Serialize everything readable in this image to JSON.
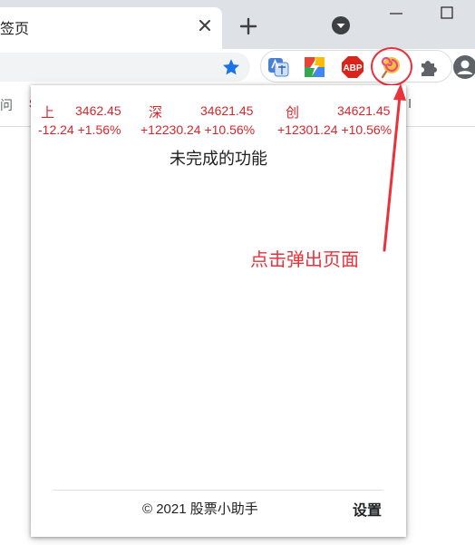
{
  "browser": {
    "tab_title": "签页",
    "bookmarks_left": "问",
    "bookmarks_left_red": "S",
    "bookmarks_right": "I"
  },
  "icons": {
    "tab_close": "close-icon",
    "new_tab": "plus-icon",
    "tab_search": "chevron-down-icon",
    "minimize": "minimize-icon",
    "maximize": "maximize-icon",
    "bookmark": "star-icon",
    "extensions": [
      "translate-extension-icon",
      "lightning-extension-icon",
      "adblock-plus-icon",
      "lollipop-extension-icon",
      "puzzle-icon"
    ],
    "profile": "profile-icon"
  },
  "extensions": {
    "abp_label": "ABP"
  },
  "popup": {
    "indices": [
      {
        "name": "上",
        "value": "3462.45",
        "change": "-12.24 +1.56%"
      },
      {
        "name": "深",
        "value": "34621.45",
        "change": "+12230.24 +10.56%"
      },
      {
        "name": "创",
        "value": "34621.45",
        "change": "+12301.24 +10.56%"
      }
    ],
    "placeholder": "未完成的功能",
    "copyright": "© 2021 股票小助手",
    "settings": "设置"
  },
  "annotation": {
    "text": "点击弹出页面"
  },
  "colors": {
    "index_red": "#d7262b",
    "annotation_red": "#e8323c",
    "star_blue": "#1a73e8"
  }
}
